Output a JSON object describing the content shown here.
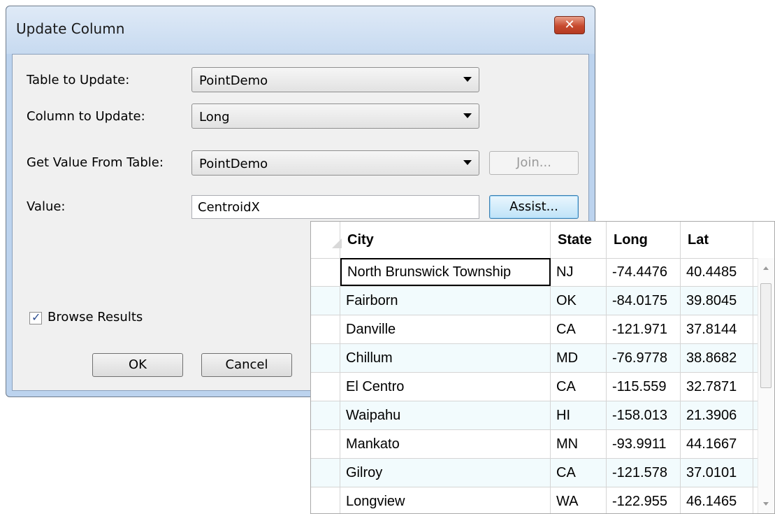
{
  "dialog": {
    "title": "Update Column",
    "close_icon": "close-icon"
  },
  "form": {
    "table_to_update_label": "Table to Update:",
    "table_to_update_value": "PointDemo",
    "column_to_update_label": "Column to Update:",
    "column_to_update_value": "Long",
    "get_value_from_table_label": "Get Value From Table:",
    "get_value_from_table_value": "PointDemo",
    "join_button": "Join...",
    "value_label": "Value:",
    "value_text": "CentroidX",
    "assist_button": "Assist...",
    "browse_results_label": "Browse Results",
    "browse_results_checked": true,
    "ok_button": "OK",
    "cancel_button": "Cancel"
  },
  "grid": {
    "columns": [
      "City",
      "State",
      "Long",
      "Lat"
    ],
    "rows": [
      [
        "North Brunswick Township",
        "NJ",
        "-74.4476",
        "40.4485"
      ],
      [
        "Fairborn",
        "OK",
        "-84.0175",
        "39.8045"
      ],
      [
        "Danville",
        "CA",
        "-121.971",
        "37.8144"
      ],
      [
        "Chillum",
        "MD",
        "-76.9778",
        "38.8682"
      ],
      [
        "El Centro",
        "CA",
        "-115.559",
        "32.7871"
      ],
      [
        "Waipahu",
        "HI",
        "-158.013",
        "21.3906"
      ],
      [
        "Mankato",
        "MN",
        "-93.9911",
        "44.1667"
      ],
      [
        "Gilroy",
        "CA",
        "-121.578",
        "37.0101"
      ],
      [
        "Longview",
        "WA",
        "-122.955",
        "46.1465"
      ]
    ]
  }
}
